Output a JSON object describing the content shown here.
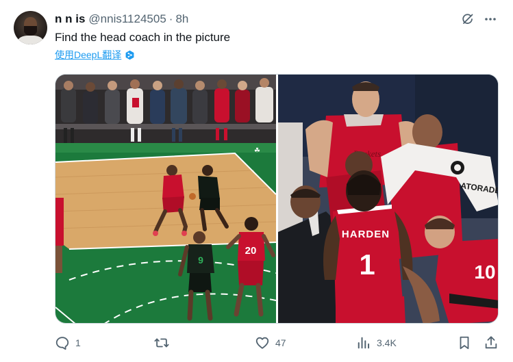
{
  "post": {
    "display_name": "n n is",
    "handle": "@nnis1124505",
    "separator": "·",
    "time": "8h",
    "text": "Find the head coach in the picture",
    "translate_label": "使用DeepL翻译"
  },
  "photos": {
    "left": {
      "jersey_number": "20",
      "opponent_number": "9"
    },
    "right": {
      "harden_name": "HARDEN",
      "harden_number": "1",
      "bench_number": "10",
      "towel_text": "ATORADE"
    }
  },
  "actions": {
    "replies": "1",
    "likes": "47",
    "views": "3.4K"
  },
  "icons": {
    "grok": "grok-icon",
    "more": "more-icon",
    "reply": "reply-icon",
    "retweet": "retweet-icon",
    "like": "heart-icon",
    "views": "views-icon",
    "bookmark": "bookmark-icon",
    "share": "share-icon"
  },
  "colors": {
    "link": "#1d9bf0",
    "secondary_text": "#536471",
    "primary_text": "#0f1419",
    "rockets_red": "#c8102e",
    "celtics_green": "#1f7a3a"
  }
}
